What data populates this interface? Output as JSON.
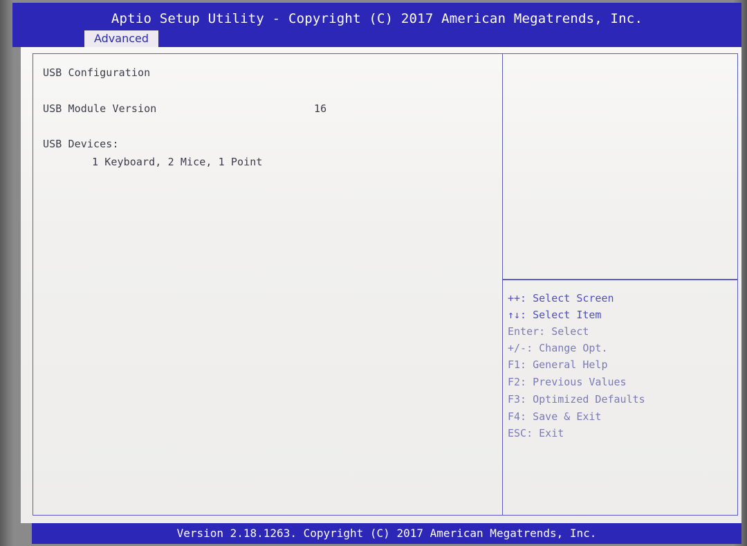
{
  "header": {
    "title": "Aptio Setup Utility - Copyright (C) 2017 American Megatrends, Inc.",
    "active_tab": "Advanced"
  },
  "main": {
    "section_title": "USB Configuration",
    "module_version_label": "USB Module Version",
    "module_version_value": "16",
    "devices_label": "USB Devices:",
    "devices_value": "1 Keyboard, 2 Mice, 1 Point"
  },
  "help": {
    "items": [
      "++: Select Screen",
      "↑↓: Select Item",
      "Enter: Select",
      "+/-: Change Opt.",
      "F1: General Help",
      "F2: Previous Values",
      "F3: Optimized Defaults",
      "F4: Save & Exit",
      "ESC: Exit"
    ]
  },
  "footer": {
    "text": "Version 2.18.1263. Copyright (C) 2017 American Megatrends, Inc."
  },
  "colors": {
    "header_blue": "#2d27b8",
    "panel_border": "#5a5ac0",
    "background": "#f1f0ee"
  }
}
